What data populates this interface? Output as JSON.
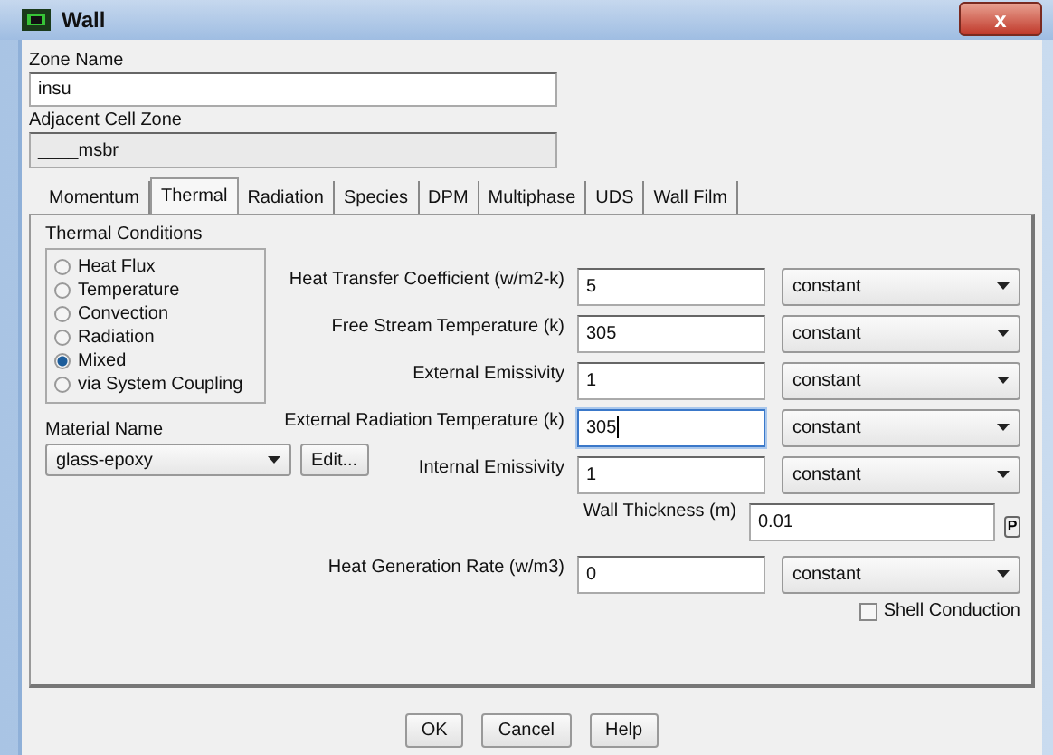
{
  "window": {
    "title": "Wall",
    "close": "x"
  },
  "zone_name": {
    "label": "Zone Name",
    "value": "insu"
  },
  "adjacent_cell_zone": {
    "label": "Adjacent Cell Zone",
    "value": "____msbr"
  },
  "tabs": [
    {
      "label": "Momentum",
      "selected": false
    },
    {
      "label": "Thermal",
      "selected": true
    },
    {
      "label": "Radiation",
      "selected": false
    },
    {
      "label": "Species",
      "selected": false
    },
    {
      "label": "DPM",
      "selected": false
    },
    {
      "label": "Multiphase",
      "selected": false
    },
    {
      "label": "UDS",
      "selected": false
    },
    {
      "label": "Wall Film",
      "selected": false
    }
  ],
  "thermal_conditions": {
    "title": "Thermal Conditions",
    "options": [
      {
        "label": "Heat Flux",
        "selected": false
      },
      {
        "label": "Temperature",
        "selected": false
      },
      {
        "label": "Convection",
        "selected": false
      },
      {
        "label": "Radiation",
        "selected": false
      },
      {
        "label": "Mixed",
        "selected": true
      },
      {
        "label": "via System Coupling",
        "selected": false
      }
    ]
  },
  "material": {
    "label": "Material Name",
    "value": "glass-epoxy",
    "edit_button": "Edit..."
  },
  "fields": [
    {
      "kind": "method",
      "label": "Heat Transfer Coefficient (w/m2-k)",
      "value": "5",
      "method": "constant",
      "focused": false
    },
    {
      "kind": "method",
      "label": "Free Stream Temperature (k)",
      "value": "305",
      "method": "constant",
      "focused": false
    },
    {
      "kind": "method",
      "label": "External Emissivity",
      "value": "1",
      "method": "constant",
      "focused": false
    },
    {
      "kind": "method",
      "label": "External Radiation Temperature (k)",
      "value": "305",
      "method": "constant",
      "focused": true
    },
    {
      "kind": "method",
      "label": "Internal Emissivity",
      "value": "1",
      "method": "constant",
      "focused": false
    },
    {
      "kind": "parameter",
      "label": "Wall Thickness (m)",
      "value": "0.01",
      "button": "P",
      "focused": false
    },
    {
      "kind": "method",
      "label": "Heat Generation Rate (w/m3)",
      "value": "0",
      "method": "constant",
      "focused": false
    }
  ],
  "shell_conduction": {
    "label": "Shell Conduction",
    "checked": false
  },
  "buttons": [
    "OK",
    "Cancel",
    "Help"
  ]
}
